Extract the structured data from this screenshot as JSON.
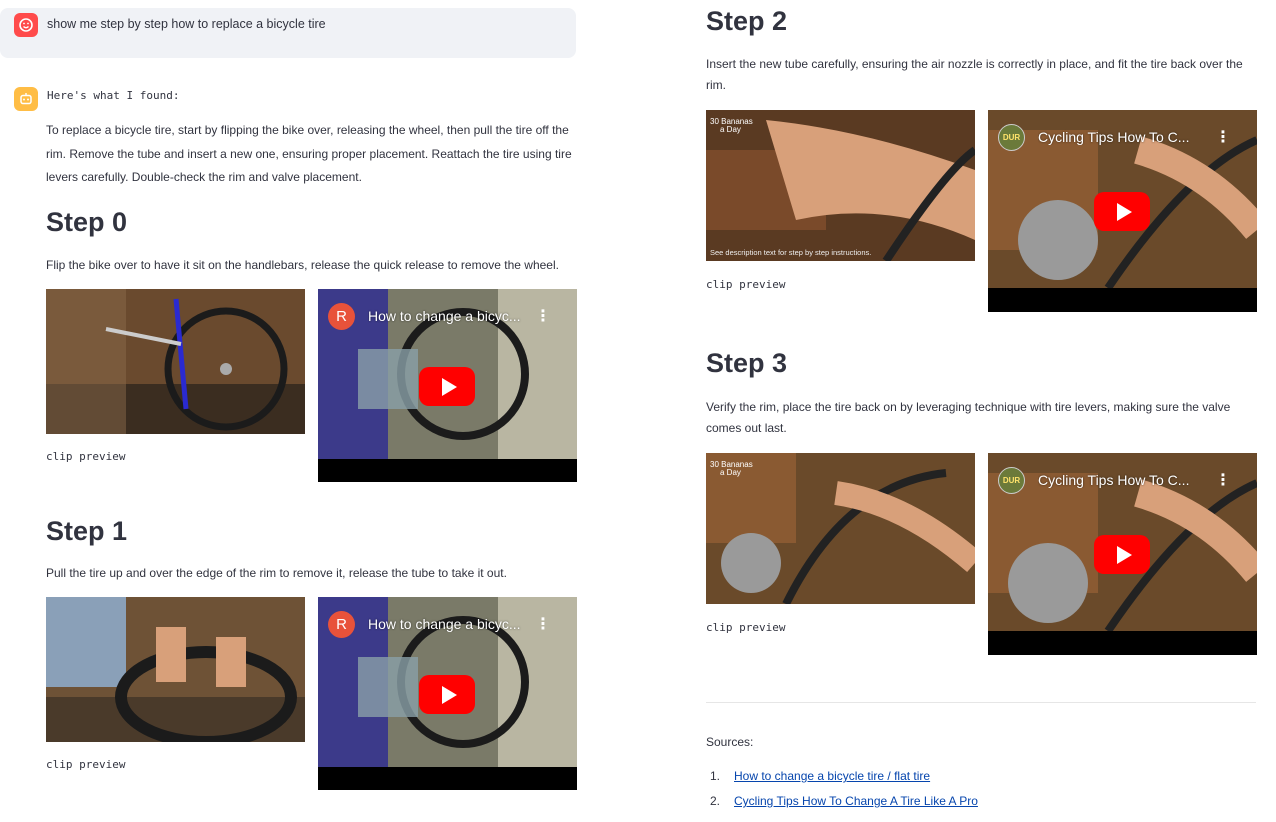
{
  "chat": {
    "user_message": "show me step by step how to replace a bicycle tire",
    "bot_intro": "Here's what I found:",
    "summary": "To replace a bicycle tire, start by flipping the bike over, releasing the wheel, then pull the tire off the rim. Remove the tube and insert a new one, ensuring proper placement. Reattach the tire using tire levers carefully. Double-check the rim and valve placement."
  },
  "steps": [
    {
      "title": "Step 0",
      "description": "Flip the bike over to have it sit on the handlebars, release the quick release to remove the wheel.",
      "clip_label": "clip preview",
      "video": {
        "title": "How to change a bicyc...",
        "channel_icon_letter": "R"
      }
    },
    {
      "title": "Step 1",
      "description": "Pull the tire up and over the edge of the rim to remove it, release the tube to take it out.",
      "clip_label": "clip preview",
      "video": {
        "title": "How to change a bicyc...",
        "channel_icon_letter": "R"
      }
    },
    {
      "title": "Step 2",
      "description": "Insert the new tube carefully, ensuring the air nozzle is correctly in place, and fit the tire back over the rim.",
      "clip_label": "clip preview",
      "clip_watermark": "30 Bananas a Day",
      "clip_caption": "See description text for step by step instructions.",
      "video": {
        "title": "Cycling Tips How To C...",
        "channel_icon_letter": "DUR"
      }
    },
    {
      "title": "Step 3",
      "description": "Verify the rim, place the tire back on by leveraging technique with tire levers, making sure the valve comes out last.",
      "clip_label": "clip preview",
      "clip_watermark": "30 Bananas a Day",
      "video": {
        "title": "Cycling Tips How To C...",
        "channel_icon_letter": "DUR"
      }
    }
  ],
  "sources": {
    "label": "Sources:",
    "items": [
      {
        "num": "1.",
        "text": "How to change a bicycle tire / flat tire"
      },
      {
        "num": "2.",
        "text": "Cycling Tips How To Change A Tire Like A Pro"
      }
    ]
  },
  "colors": {
    "user_avatar": "#ff4b4b",
    "bot_avatar": "#ffbd45",
    "link": "#0645ad",
    "youtube_red": "#ff0000"
  },
  "icons": {
    "user_avatar": "user-face-icon",
    "bot_avatar": "robot-face-icon",
    "play": "youtube-play-icon",
    "menu": "kebab-menu-icon"
  }
}
